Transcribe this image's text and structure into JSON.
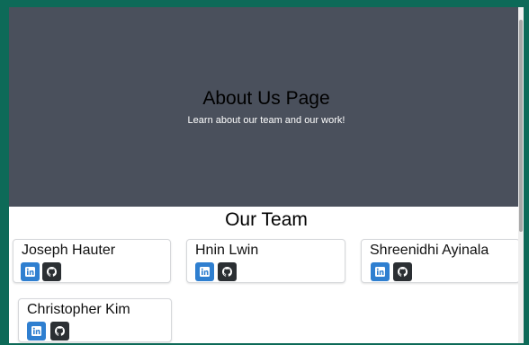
{
  "hero": {
    "title": "About Us Page",
    "subtitle": "Learn about our team and our work!"
  },
  "team": {
    "title": "Our Team",
    "members": [
      {
        "name": "Joseph Hauter"
      },
      {
        "name": "Hnin Lwin"
      },
      {
        "name": "Shreenidhi Ayinala"
      },
      {
        "name": "Christopher Kim"
      }
    ]
  },
  "icons": {
    "linkedin": "linkedin-icon",
    "github": "github-icon"
  },
  "colors": {
    "page_border": "#0d6a58",
    "hero_background": "#4a505c",
    "linkedin_button": "#2f7fd0",
    "github_button": "#2b2f33"
  }
}
